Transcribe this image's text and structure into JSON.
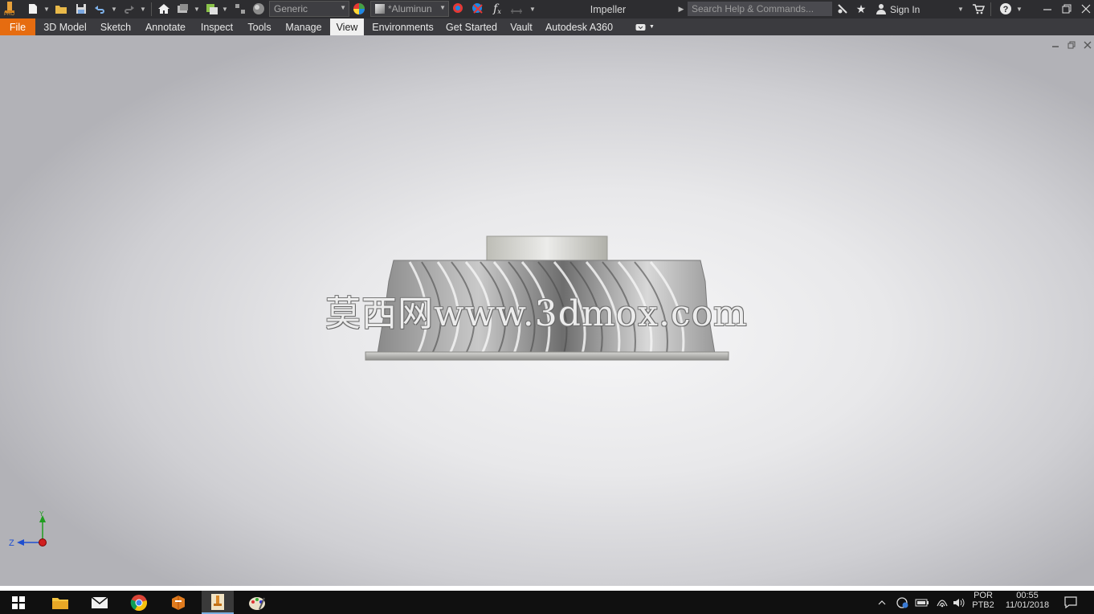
{
  "app": {
    "logo_badge": "PRO"
  },
  "toolbar": {
    "material_combo": "Generic",
    "appearance_combo": "*Aluminun",
    "fx_label": "f",
    "fx_sub": "x"
  },
  "title": {
    "document": "Impeller"
  },
  "search": {
    "placeholder": "Search Help & Commands..."
  },
  "account": {
    "sign_in": "Sign In"
  },
  "ribbon": {
    "tabs": [
      "File",
      "3D Model",
      "Sketch",
      "Annotate",
      "Inspect",
      "Tools",
      "Manage",
      "View",
      "Environments",
      "Get Started",
      "Vault",
      "Autodesk A360"
    ],
    "active": "View"
  },
  "viewport": {
    "watermark": "莫西网www.3dmox.com",
    "triad": {
      "y_label": "Y",
      "z_label": "Z"
    },
    "colors": {
      "background": "#e8e8ea",
      "axis_y": "#1f9d1f",
      "axis_z": "#1f4fd0",
      "origin": "#d01f1f"
    }
  },
  "taskbar": {
    "language": "POR",
    "layout": "PTB2",
    "time": "00:55",
    "date": "11/01/2018"
  }
}
